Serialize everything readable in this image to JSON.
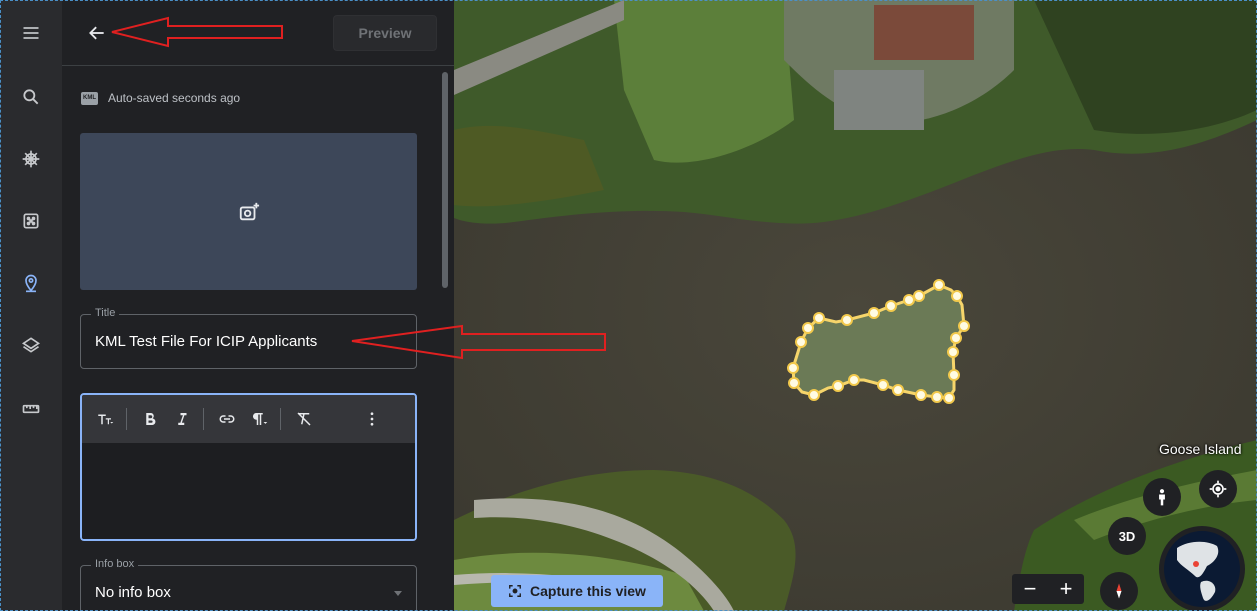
{
  "rail": {
    "items": [
      {
        "name": "menu",
        "icon": "menu-icon"
      },
      {
        "name": "search",
        "icon": "search-icon"
      },
      {
        "name": "voyager",
        "icon": "helm-icon"
      },
      {
        "name": "feeling-lucky",
        "icon": "dice-icon"
      },
      {
        "name": "projects",
        "icon": "location-pin-icon",
        "active": true
      },
      {
        "name": "map-style",
        "icon": "layers-icon"
      },
      {
        "name": "measure",
        "icon": "ruler-icon"
      }
    ],
    "active_color": "#8ab4f8"
  },
  "panel": {
    "back_icon": "arrow-left-icon",
    "preview_label": "Preview",
    "autosave_badge": "KML",
    "autosave_text": "Auto-saved seconds ago",
    "add_image_icon": "add-photo-icon",
    "title_label": "Title",
    "title_value": "KML Test File For ICIP Applicants",
    "editor": {
      "tools": [
        "text-size-icon",
        "bold-icon",
        "italic-icon",
        "link-icon",
        "paragraph-icon",
        "clear-format-icon",
        "more-vert-icon"
      ],
      "content": ""
    },
    "infobox_label": "Info box",
    "infobox_value": "No info box"
  },
  "map": {
    "place_label": "Goose Island",
    "capture_label": "Capture this view",
    "btn_3d": "3D",
    "zoom_minus": "−",
    "zoom_plus": "+",
    "pegman_icon": "pegman-icon",
    "locate_icon": "my-location-icon",
    "compass_icon": "compass-icon",
    "polygon_color": "#f6d56b"
  }
}
